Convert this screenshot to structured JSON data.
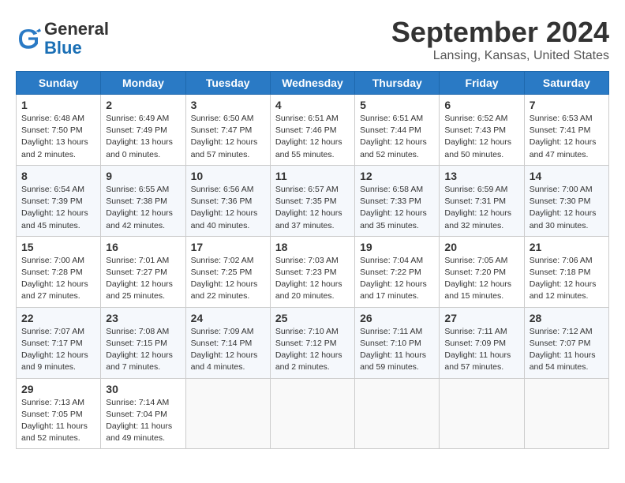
{
  "header": {
    "logo_general": "General",
    "logo_blue": "Blue",
    "month_title": "September 2024",
    "location": "Lansing, Kansas, United States"
  },
  "days_of_week": [
    "Sunday",
    "Monday",
    "Tuesday",
    "Wednesday",
    "Thursday",
    "Friday",
    "Saturday"
  ],
  "weeks": [
    [
      {
        "day": "1",
        "info": "Sunrise: 6:48 AM\nSunset: 7:50 PM\nDaylight: 13 hours\nand 2 minutes."
      },
      {
        "day": "2",
        "info": "Sunrise: 6:49 AM\nSunset: 7:49 PM\nDaylight: 13 hours\nand 0 minutes."
      },
      {
        "day": "3",
        "info": "Sunrise: 6:50 AM\nSunset: 7:47 PM\nDaylight: 12 hours\nand 57 minutes."
      },
      {
        "day": "4",
        "info": "Sunrise: 6:51 AM\nSunset: 7:46 PM\nDaylight: 12 hours\nand 55 minutes."
      },
      {
        "day": "5",
        "info": "Sunrise: 6:51 AM\nSunset: 7:44 PM\nDaylight: 12 hours\nand 52 minutes."
      },
      {
        "day": "6",
        "info": "Sunrise: 6:52 AM\nSunset: 7:43 PM\nDaylight: 12 hours\nand 50 minutes."
      },
      {
        "day": "7",
        "info": "Sunrise: 6:53 AM\nSunset: 7:41 PM\nDaylight: 12 hours\nand 47 minutes."
      }
    ],
    [
      {
        "day": "8",
        "info": "Sunrise: 6:54 AM\nSunset: 7:39 PM\nDaylight: 12 hours\nand 45 minutes."
      },
      {
        "day": "9",
        "info": "Sunrise: 6:55 AM\nSunset: 7:38 PM\nDaylight: 12 hours\nand 42 minutes."
      },
      {
        "day": "10",
        "info": "Sunrise: 6:56 AM\nSunset: 7:36 PM\nDaylight: 12 hours\nand 40 minutes."
      },
      {
        "day": "11",
        "info": "Sunrise: 6:57 AM\nSunset: 7:35 PM\nDaylight: 12 hours\nand 37 minutes."
      },
      {
        "day": "12",
        "info": "Sunrise: 6:58 AM\nSunset: 7:33 PM\nDaylight: 12 hours\nand 35 minutes."
      },
      {
        "day": "13",
        "info": "Sunrise: 6:59 AM\nSunset: 7:31 PM\nDaylight: 12 hours\nand 32 minutes."
      },
      {
        "day": "14",
        "info": "Sunrise: 7:00 AM\nSunset: 7:30 PM\nDaylight: 12 hours\nand 30 minutes."
      }
    ],
    [
      {
        "day": "15",
        "info": "Sunrise: 7:00 AM\nSunset: 7:28 PM\nDaylight: 12 hours\nand 27 minutes."
      },
      {
        "day": "16",
        "info": "Sunrise: 7:01 AM\nSunset: 7:27 PM\nDaylight: 12 hours\nand 25 minutes."
      },
      {
        "day": "17",
        "info": "Sunrise: 7:02 AM\nSunset: 7:25 PM\nDaylight: 12 hours\nand 22 minutes."
      },
      {
        "day": "18",
        "info": "Sunrise: 7:03 AM\nSunset: 7:23 PM\nDaylight: 12 hours\nand 20 minutes."
      },
      {
        "day": "19",
        "info": "Sunrise: 7:04 AM\nSunset: 7:22 PM\nDaylight: 12 hours\nand 17 minutes."
      },
      {
        "day": "20",
        "info": "Sunrise: 7:05 AM\nSunset: 7:20 PM\nDaylight: 12 hours\nand 15 minutes."
      },
      {
        "day": "21",
        "info": "Sunrise: 7:06 AM\nSunset: 7:18 PM\nDaylight: 12 hours\nand 12 minutes."
      }
    ],
    [
      {
        "day": "22",
        "info": "Sunrise: 7:07 AM\nSunset: 7:17 PM\nDaylight: 12 hours\nand 9 minutes."
      },
      {
        "day": "23",
        "info": "Sunrise: 7:08 AM\nSunset: 7:15 PM\nDaylight: 12 hours\nand 7 minutes."
      },
      {
        "day": "24",
        "info": "Sunrise: 7:09 AM\nSunset: 7:14 PM\nDaylight: 12 hours\nand 4 minutes."
      },
      {
        "day": "25",
        "info": "Sunrise: 7:10 AM\nSunset: 7:12 PM\nDaylight: 12 hours\nand 2 minutes."
      },
      {
        "day": "26",
        "info": "Sunrise: 7:11 AM\nSunset: 7:10 PM\nDaylight: 11 hours\nand 59 minutes."
      },
      {
        "day": "27",
        "info": "Sunrise: 7:11 AM\nSunset: 7:09 PM\nDaylight: 11 hours\nand 57 minutes."
      },
      {
        "day": "28",
        "info": "Sunrise: 7:12 AM\nSunset: 7:07 PM\nDaylight: 11 hours\nand 54 minutes."
      }
    ],
    [
      {
        "day": "29",
        "info": "Sunrise: 7:13 AM\nSunset: 7:05 PM\nDaylight: 11 hours\nand 52 minutes."
      },
      {
        "day": "30",
        "info": "Sunrise: 7:14 AM\nSunset: 7:04 PM\nDaylight: 11 hours\nand 49 minutes."
      },
      {
        "day": "",
        "info": ""
      },
      {
        "day": "",
        "info": ""
      },
      {
        "day": "",
        "info": ""
      },
      {
        "day": "",
        "info": ""
      },
      {
        "day": "",
        "info": ""
      }
    ]
  ]
}
